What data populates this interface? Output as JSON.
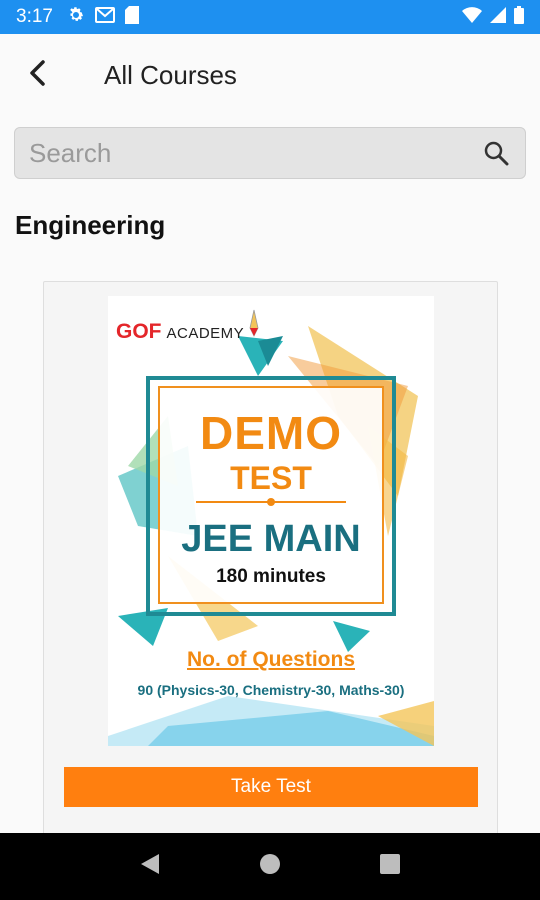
{
  "status_bar": {
    "time": "3:17",
    "icons": [
      "gear-icon",
      "gmail-icon",
      "sd-card-icon",
      "wifi-icon",
      "signal-icon",
      "battery-icon"
    ]
  },
  "app_bar": {
    "title": "All Courses",
    "back_icon": "back-arrow-icon"
  },
  "search": {
    "placeholder": "Search",
    "value": "",
    "icon": "search-icon"
  },
  "section": {
    "title": "Engineering"
  },
  "course_card": {
    "poster": {
      "brand": "GOF",
      "brand_suffix": "ACADEMY",
      "headline": "DEMO",
      "subheadline": "TEST",
      "exam": "JEE MAIN",
      "duration": "180 minutes",
      "questions_title": "No. of Questions",
      "questions_detail": "90 (Physics-30, Chemistry-30, Maths-30)"
    },
    "button_label": "Take Test"
  },
  "colors": {
    "status_bar": "#1e90f0",
    "accent_orange": "#ff7f0f",
    "teal": "#1f8a94"
  },
  "nav_bar": {
    "icons": [
      "back-triangle-icon",
      "home-circle-icon",
      "recents-square-icon"
    ]
  }
}
